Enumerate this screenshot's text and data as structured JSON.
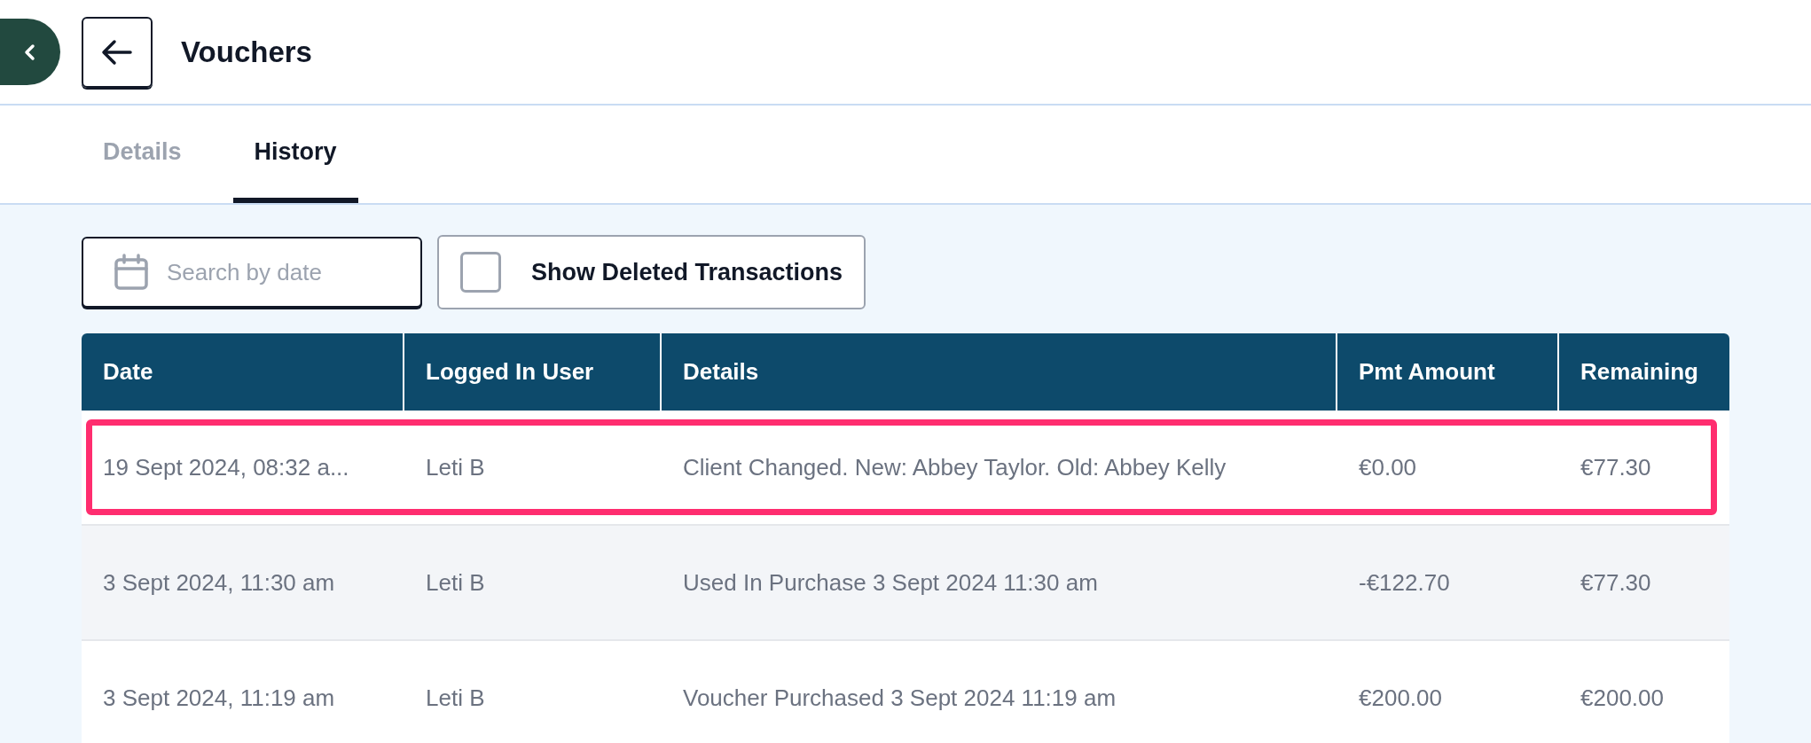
{
  "header": {
    "title": "Vouchers"
  },
  "tabs": [
    {
      "label": "Details",
      "selected": false
    },
    {
      "label": "History",
      "selected": true
    }
  ],
  "filters": {
    "search": {
      "placeholder": "Search by date"
    },
    "show_deleted": {
      "label": "Show Deleted Transactions",
      "checked": false
    }
  },
  "table": {
    "columns": [
      "Date",
      "Logged In User",
      "Details",
      "Pmt Amount",
      "Remaining"
    ],
    "rows": [
      {
        "cells": [
          "19 Sept 2024, 08:32 a...",
          "Leti B",
          "Client Changed. New: Abbey Taylor. Old: Abbey Kelly",
          "€0.00",
          "€77.30"
        ],
        "highlighted": true,
        "shaded": false
      },
      {
        "cells": [
          "3 Sept 2024, 11:30 am",
          "Leti B",
          "Used In Purchase 3 Sept 2024 11:30 am",
          "-€122.70",
          "€77.30"
        ],
        "highlighted": false,
        "shaded": true
      },
      {
        "cells": [
          "3 Sept 2024, 11:19 am",
          "Leti B",
          "Voucher Purchased 3 Sept 2024 11:19 am",
          "€200.00",
          "€200.00"
        ],
        "highlighted": false,
        "shaded": false
      }
    ]
  }
}
